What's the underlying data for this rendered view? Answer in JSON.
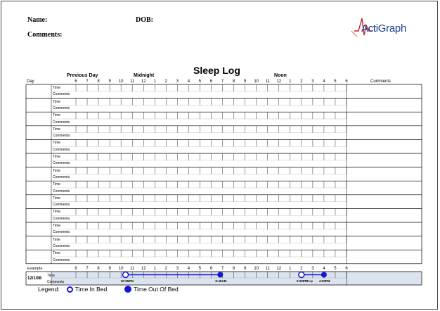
{
  "header": {
    "name_label": "Name:",
    "dob_label": "DOB:",
    "comments_label": "Comments:"
  },
  "logo": {
    "text": "ActiGraph",
    "accent_color": "#c8202a",
    "text_color": "#1a3c8c"
  },
  "title": "Sleep Log",
  "timeline_labels": {
    "previous_day": "Previous Day",
    "midnight": "Midnight",
    "noon": "Noon"
  },
  "columns": {
    "day": "Day",
    "comments": "Comments"
  },
  "hours": [
    "6",
    "7",
    "8",
    "9",
    "10",
    "11",
    "12",
    "1",
    "2",
    "3",
    "4",
    "5",
    "6",
    "7",
    "8",
    "9",
    "10",
    "11",
    "12",
    "1",
    "2",
    "3",
    "4",
    "5",
    "6"
  ],
  "row_labels": {
    "time": "Time",
    "comments": "Comments"
  },
  "day_rows": 13,
  "example": {
    "label": "Example",
    "date": "12/1/08",
    "time_label": "Time",
    "comments_label": "Comments",
    "nap_label": "Nap",
    "events": [
      {
        "type": "in_bed",
        "hour_index": 4.4,
        "time": "10:25PM"
      },
      {
        "type": "out_of_bed",
        "hour_index": 12.8,
        "time": "6:45AM"
      },
      {
        "type": "in_bed",
        "hour_index": 20.0,
        "time": "2:00PM"
      },
      {
        "type": "out_of_bed",
        "hour_index": 22.0,
        "time": "4:00PM"
      }
    ]
  },
  "legend": {
    "label": "Legend:",
    "in_bed": "Time In Bed",
    "out_of_bed": "Time Out Of Bed",
    "marker_color": "#1515d6"
  }
}
